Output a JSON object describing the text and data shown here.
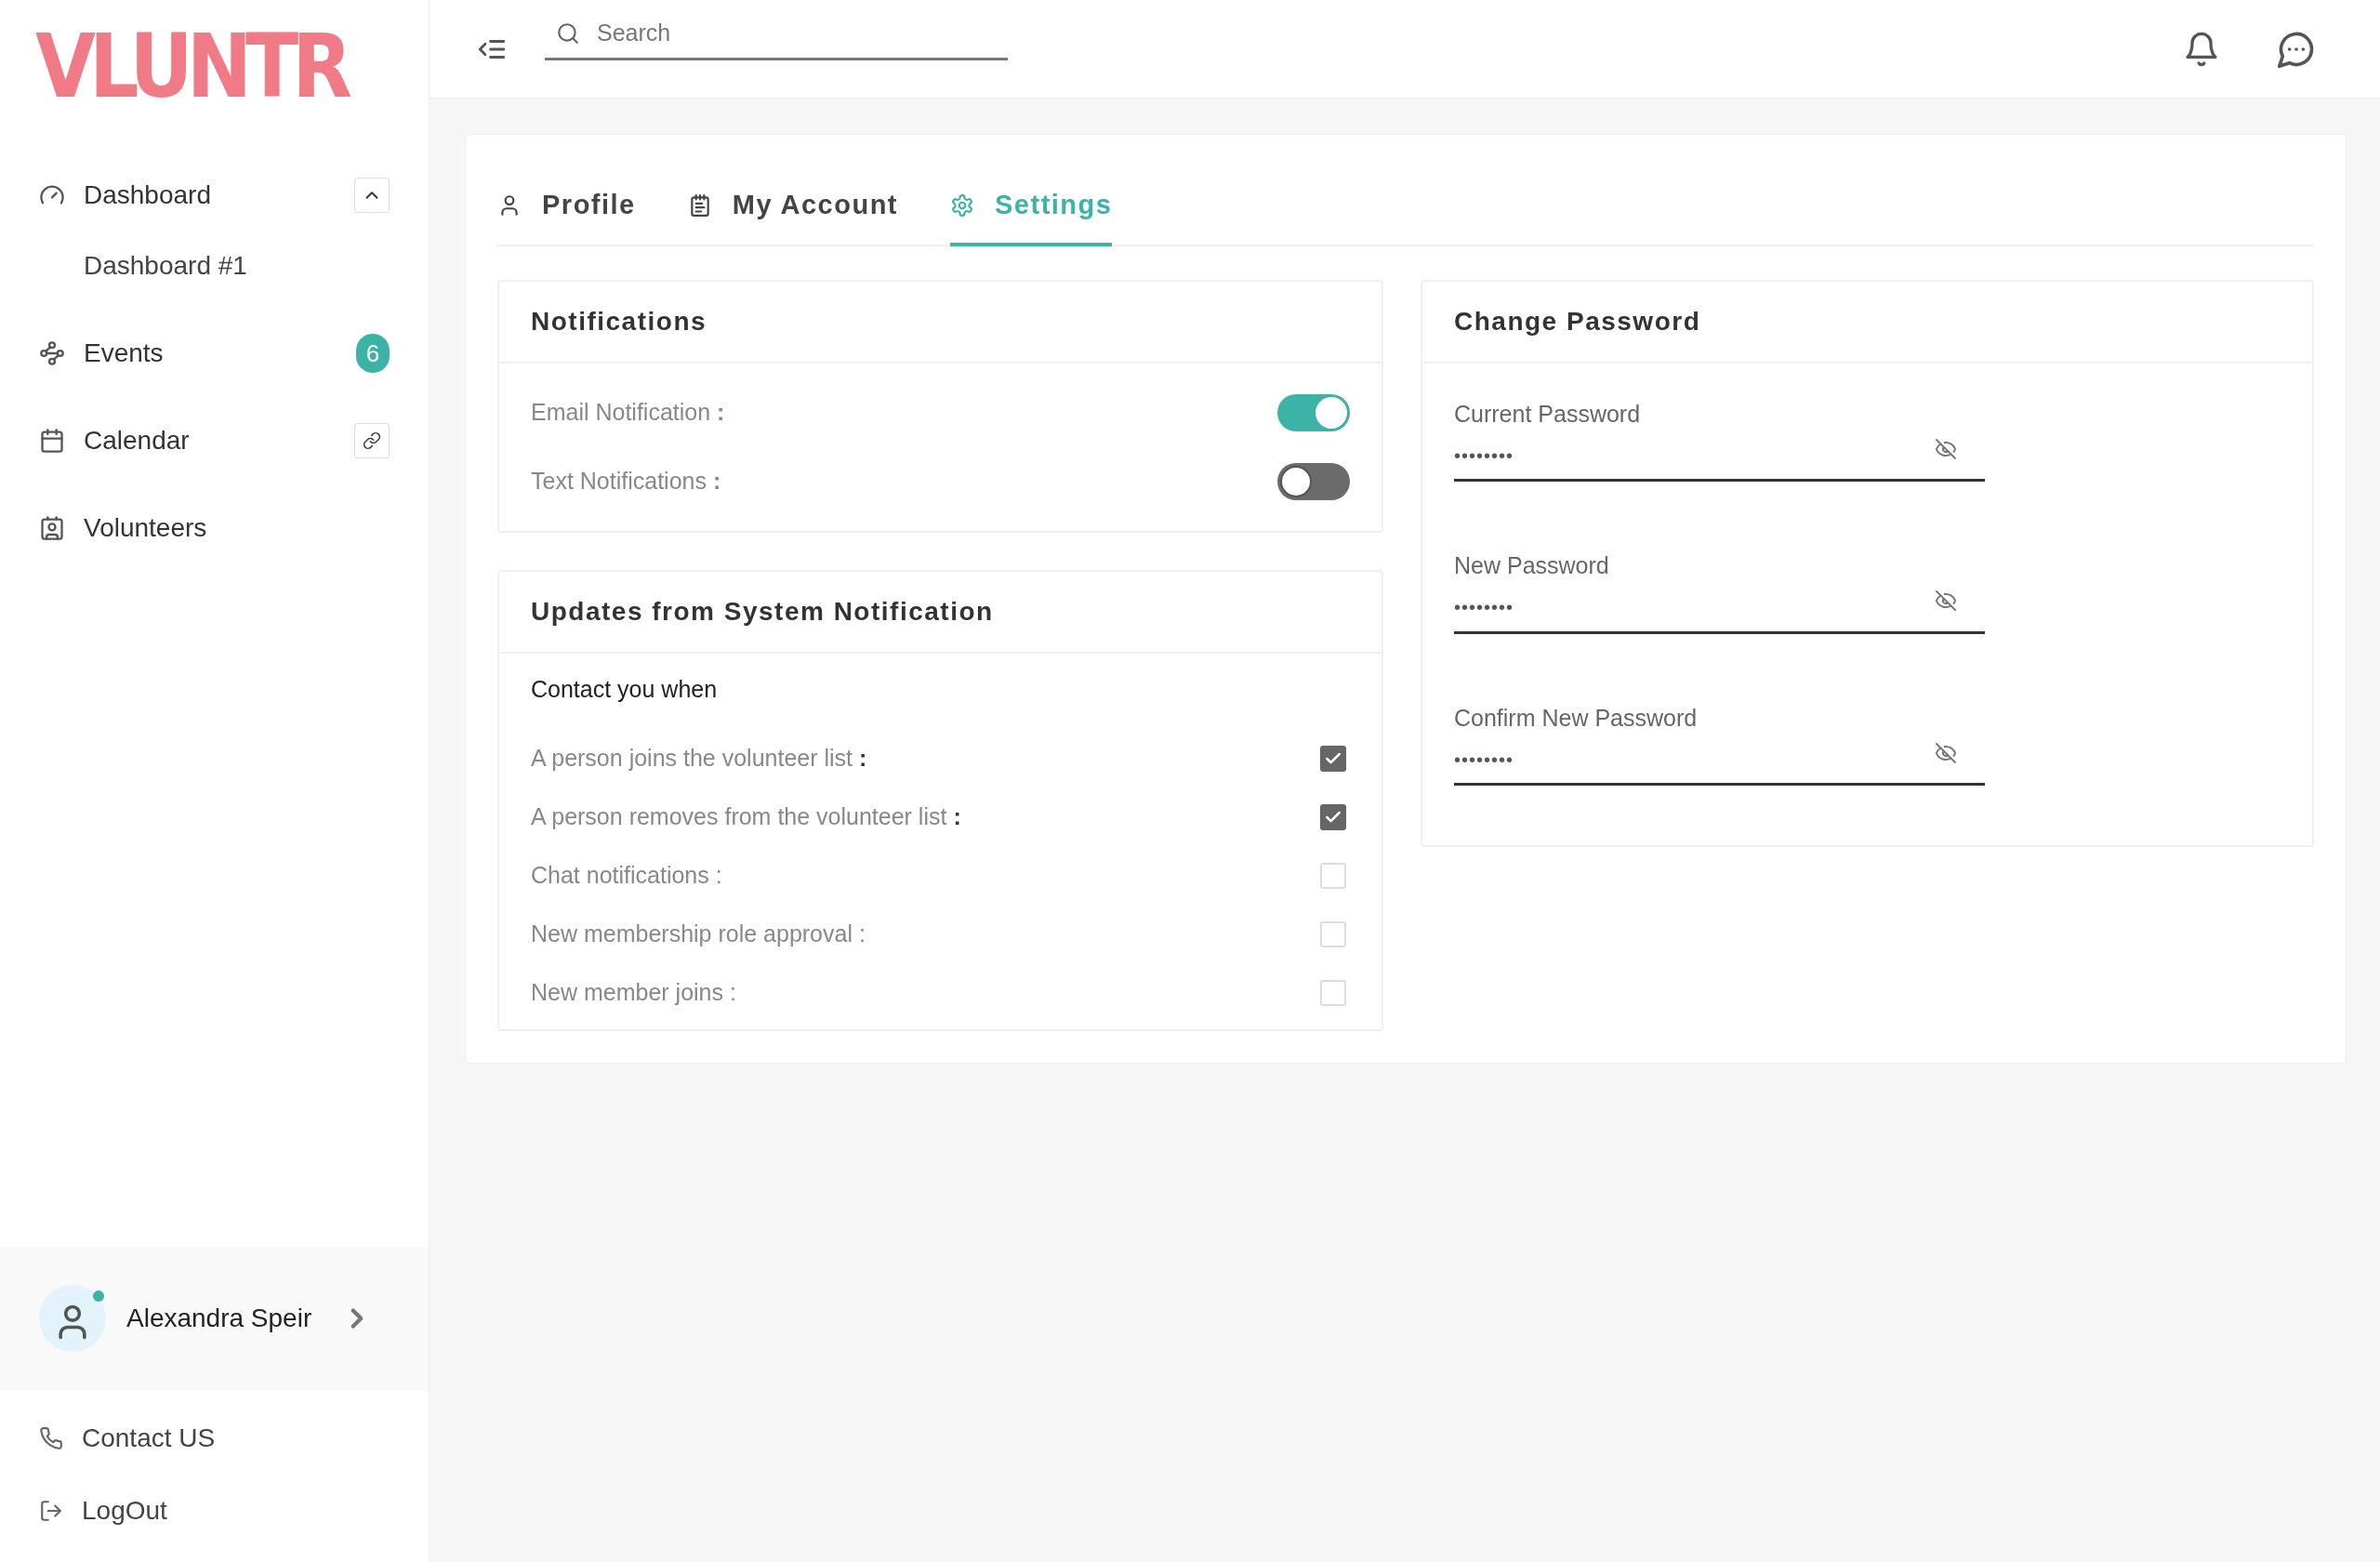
{
  "logo": "VLUNTR",
  "sidebar": {
    "items": [
      {
        "kind": "group",
        "label": "Dashboard",
        "expanded": true,
        "children": [
          {
            "label": "Dashboard #1"
          }
        ]
      },
      {
        "kind": "badge",
        "label": "Events",
        "badge": "6"
      },
      {
        "kind": "link",
        "label": "Calendar"
      },
      {
        "kind": "plain",
        "label": "Volunteers"
      }
    ],
    "user": {
      "name": "Alexandra Speir",
      "online": true
    },
    "footer": [
      {
        "kind": "contact",
        "label": "Contact US"
      },
      {
        "kind": "logout",
        "label": "LogOut"
      }
    ]
  },
  "search": {
    "placeholder": "Search"
  },
  "tabs": [
    {
      "kind": "profile",
      "label": "Profile",
      "selected": false
    },
    {
      "kind": "account",
      "label": "My Account",
      "selected": false
    },
    {
      "kind": "settings",
      "label": "Settings",
      "selected": true
    }
  ],
  "notifications": {
    "title": "Notifications",
    "toggles": [
      {
        "label": "Email Notification **:**",
        "on": true
      },
      {
        "label": "Text Notifications **:**",
        "on": false
      }
    ]
  },
  "updates": {
    "title": "Updates from System Notification",
    "subtitle": "Contact you when",
    "options": [
      {
        "label": "A person joins the volunteer list **:**",
        "checked": true
      },
      {
        "label": "A person removes from the volunteer list **:**",
        "checked": true
      },
      {
        "label": "Chat notifications :",
        "checked": false
      },
      {
        "label": "New membership role approval :",
        "checked": false
      },
      {
        "label": "New member joins :",
        "checked": false
      }
    ]
  },
  "password": {
    "title": "Change Password",
    "fields": [
      {
        "label": "Current Password",
        "value": "••••••••"
      },
      {
        "label": "New Password",
        "value": "••••••••"
      },
      {
        "label": "Confirm New Password",
        "value": "••••••••"
      }
    ]
  }
}
